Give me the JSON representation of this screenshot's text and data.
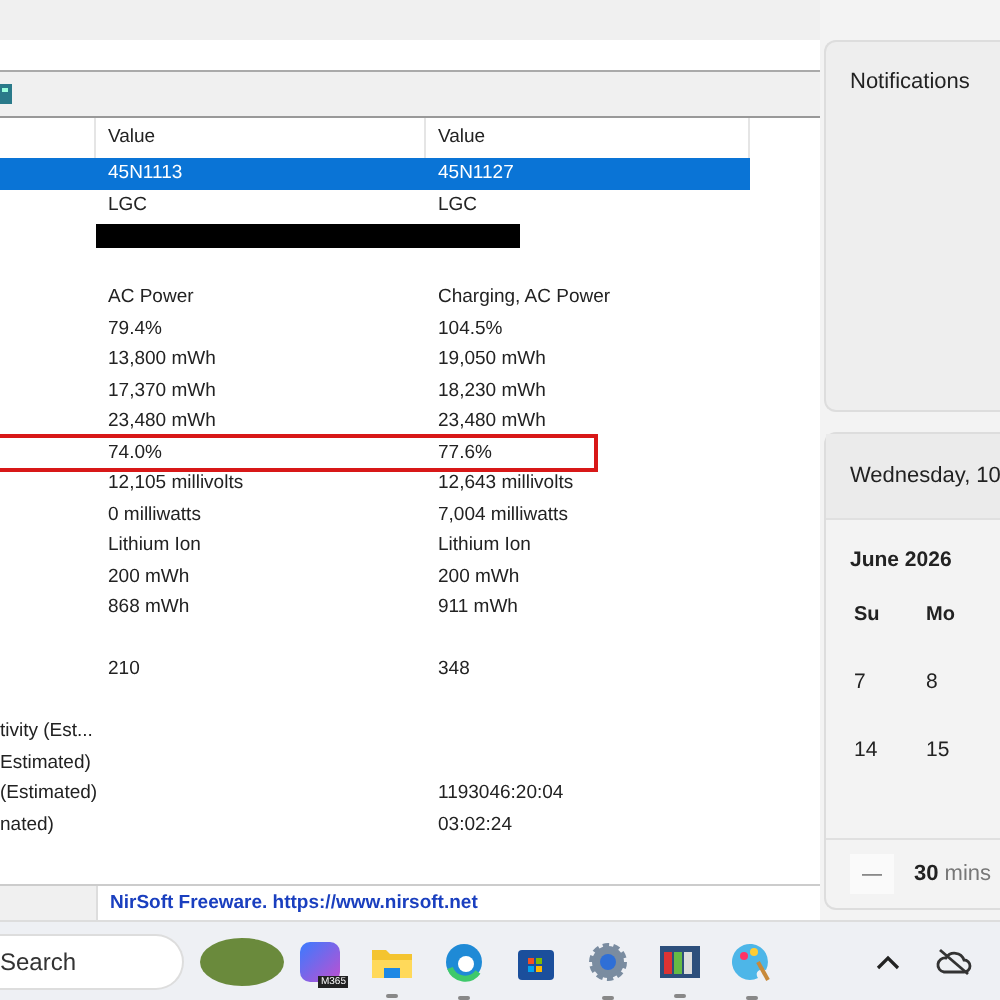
{
  "table": {
    "columns": [
      "Value",
      "Value"
    ],
    "rows": [
      {
        "kind": "data",
        "value_1": "45N1113",
        "value_2": "45N1127",
        "selected": true,
        "highlighted": false
      },
      {
        "kind": "data",
        "value_1": "LGC",
        "value_2": "LGC",
        "selected": false,
        "highlighted": false
      },
      {
        "kind": "redacted",
        "selected": false,
        "highlighted": false
      },
      {
        "kind": "data",
        "selected": false,
        "highlighted": false
      },
      {
        "kind": "data",
        "value_1": "AC Power",
        "value_2": "Charging, AC Power",
        "selected": false,
        "highlighted": false
      },
      {
        "kind": "data",
        "value_1": "79.4%",
        "value_2": "104.5%",
        "selected": false,
        "highlighted": false
      },
      {
        "kind": "data",
        "value_1": "13,800 mWh",
        "value_2": "19,050 mWh",
        "selected": false,
        "highlighted": false
      },
      {
        "kind": "data",
        "value_1": "17,370 mWh",
        "value_2": "18,230 mWh",
        "selected": false,
        "highlighted": false
      },
      {
        "kind": "data",
        "value_1": "23,480 mWh",
        "value_2": "23,480 mWh",
        "selected": false,
        "highlighted": false
      },
      {
        "kind": "data",
        "value_1": "74.0%",
        "value_2": "77.6%",
        "selected": false,
        "highlighted": true
      },
      {
        "kind": "data",
        "value_1": "12,105 millivolts",
        "value_2": "12,643 millivolts",
        "selected": false,
        "highlighted": false
      },
      {
        "kind": "data",
        "value_1": "0 milliwatts",
        "value_2": "7,004 milliwatts",
        "selected": false,
        "highlighted": false
      },
      {
        "kind": "data",
        "value_1": "Lithium Ion",
        "value_2": "Lithium Ion",
        "selected": false,
        "highlighted": false
      },
      {
        "kind": "data",
        "value_1": "200 mWh",
        "value_2": "200 mWh",
        "selected": false,
        "highlighted": false
      },
      {
        "kind": "data",
        "value_1": "868 mWh",
        "value_2": "911 mWh",
        "selected": false,
        "highlighted": false
      },
      {
        "kind": "data",
        "selected": false,
        "highlighted": false
      },
      {
        "kind": "data",
        "value_1": "210",
        "value_2": "348",
        "selected": false,
        "highlighted": false
      },
      {
        "kind": "data",
        "selected": false,
        "highlighted": false
      },
      {
        "kind": "data",
        "name": "tivity (Est...",
        "selected": false,
        "highlighted": false
      },
      {
        "kind": "data",
        "name": "Estimated)",
        "selected": false,
        "highlighted": false
      },
      {
        "kind": "data",
        "name": "(Estimated)",
        "value_2": "1193046:20:04",
        "selected": false,
        "highlighted": false
      },
      {
        "kind": "data",
        "name": "nated)",
        "value_2": "03:02:24",
        "selected": false,
        "highlighted": false
      }
    ]
  },
  "status_bar": {
    "link": "NirSoft Freeware. https://www.nirsoft.net"
  },
  "notifications": {
    "title": "Notifications"
  },
  "calendar": {
    "date": "Wednesday, 10",
    "month": "June 2026",
    "weekdays": [
      "Su",
      "Mo"
    ],
    "weeks": [
      [
        "7",
        "8"
      ],
      [
        "14",
        "15"
      ]
    ],
    "focus": {
      "minus": "—",
      "amount": "30",
      "unit": "mins"
    }
  },
  "taskbar": {
    "search": {
      "placeholder": "Search"
    },
    "badge": "M365"
  }
}
